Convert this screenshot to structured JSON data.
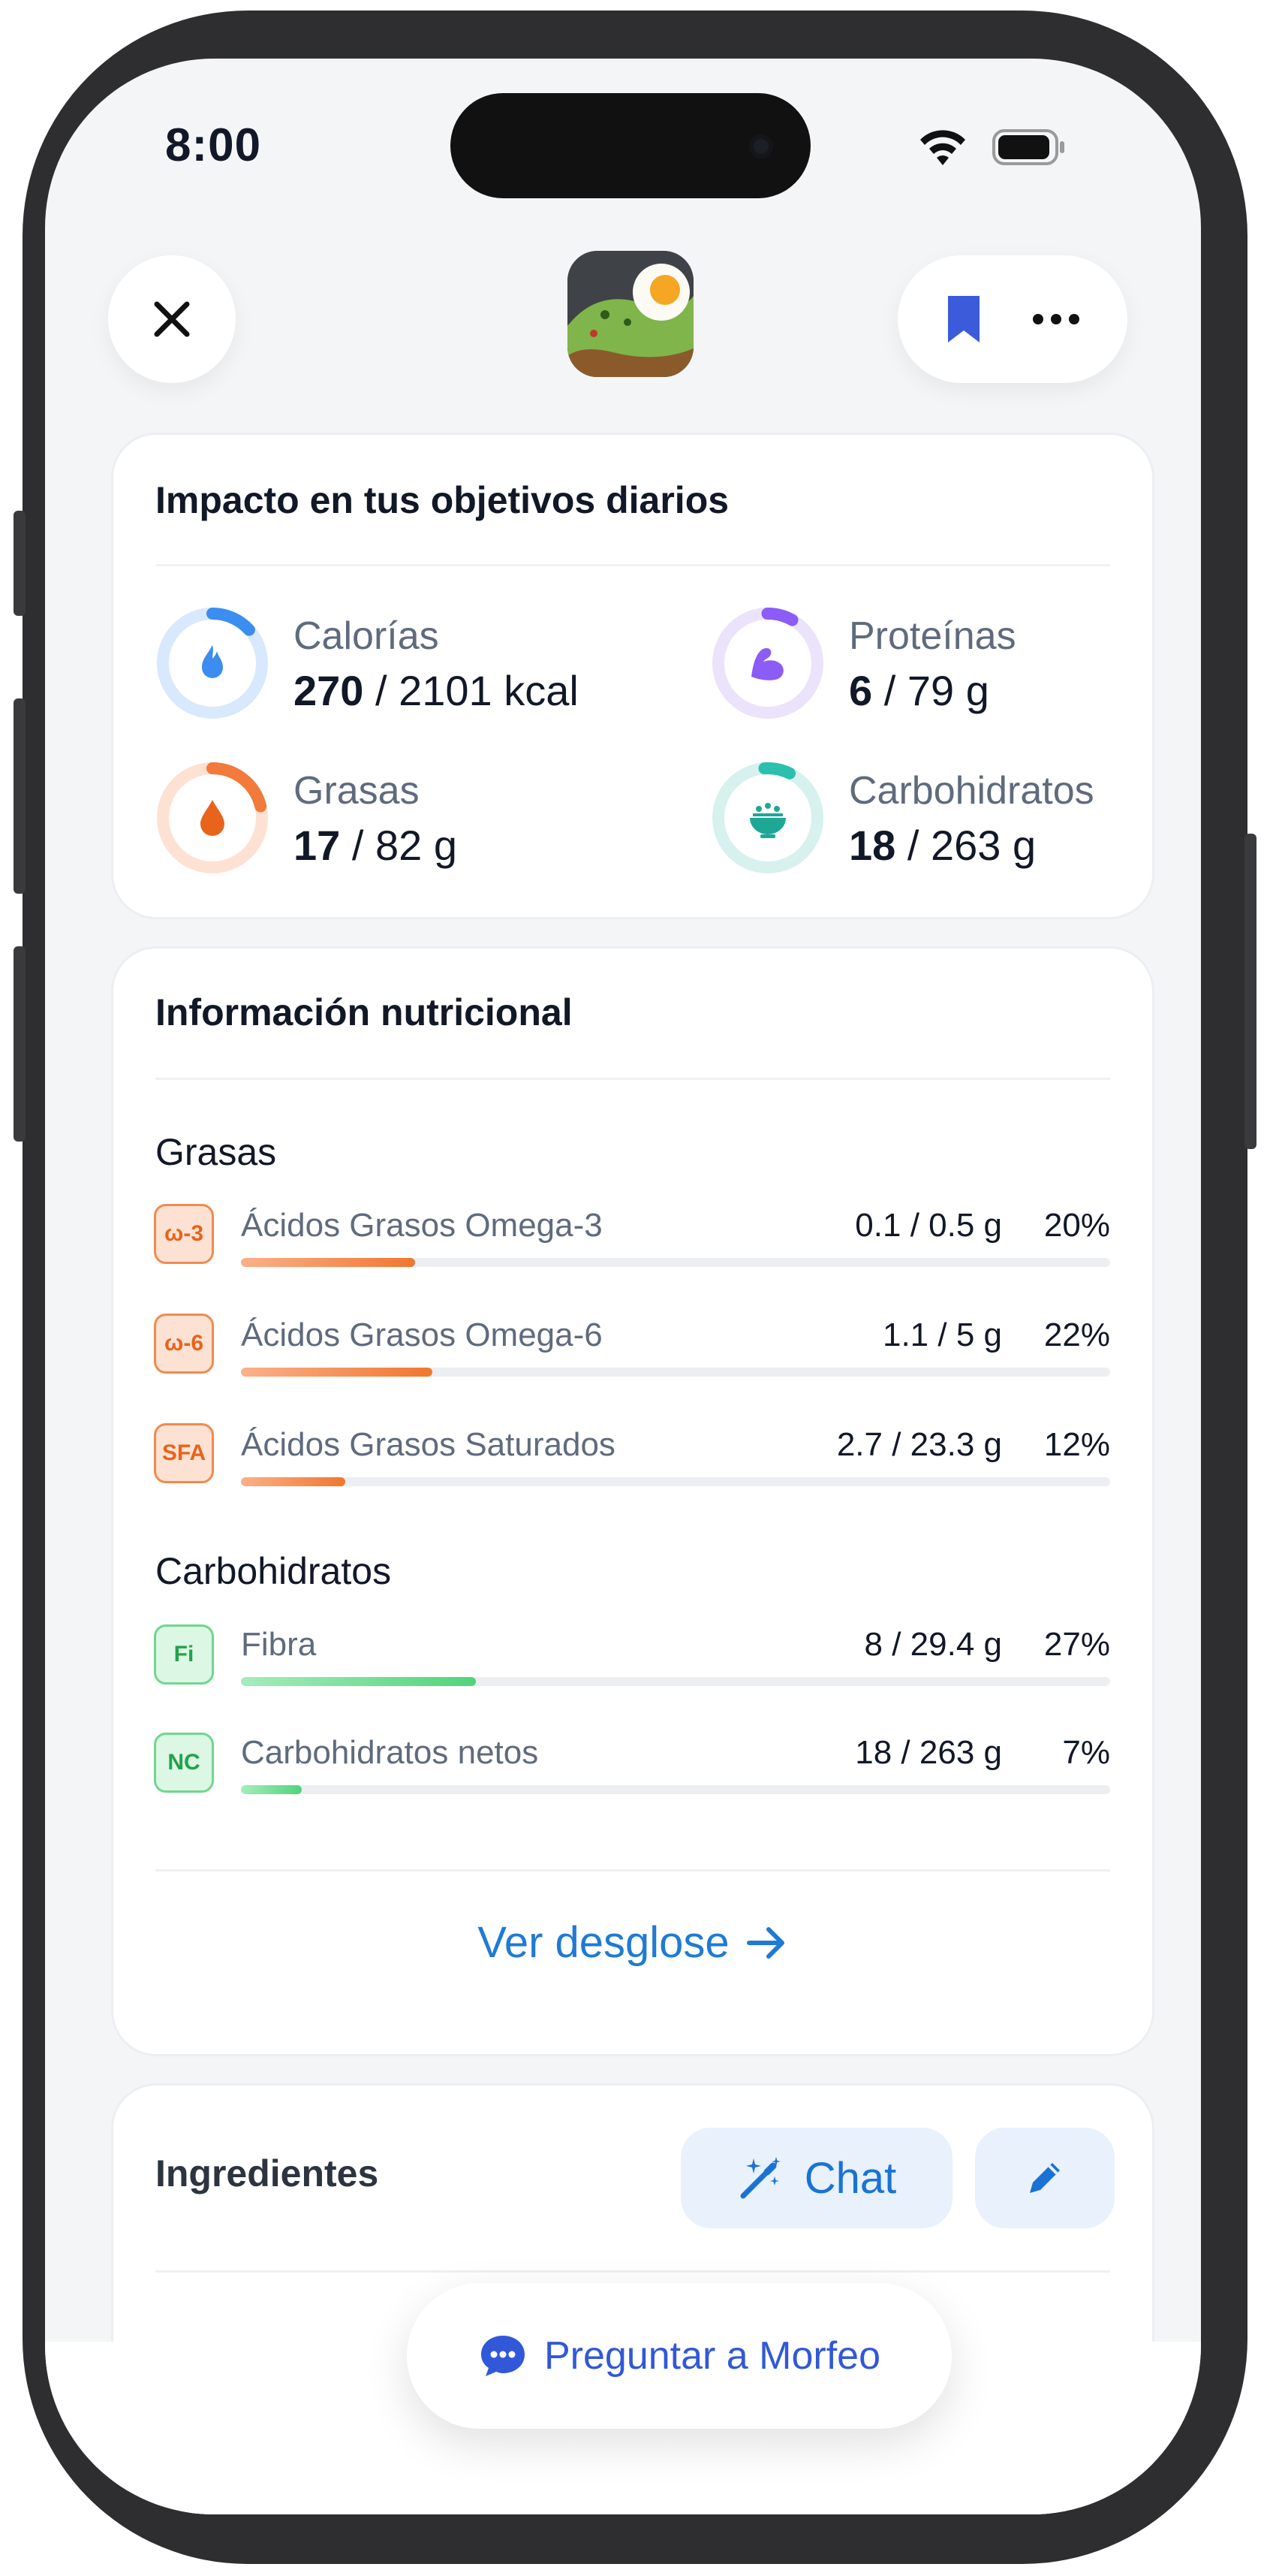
{
  "status_bar": {
    "time": "8:00"
  },
  "header": {
    "close_icon": "close-icon",
    "bookmark_icon": "bookmark-icon",
    "more_icon": "more-icon",
    "food_image": "avocado-toast-with-fried-egg"
  },
  "daily_goals": {
    "title": "Impacto en tus objetivos diarios",
    "items": [
      {
        "label": "Calorías",
        "value": "270",
        "goal": "2101 kcal",
        "icon": "flame-icon",
        "color": "#3b8df0",
        "progress": 0.13
      },
      {
        "label": "Proteínas",
        "value": "6",
        "goal": "79 g",
        "icon": "muscle-icon",
        "color": "#8b5cf6",
        "progress": 0.08
      },
      {
        "label": "Grasas",
        "value": "17",
        "goal": "82 g",
        "icon": "drop-icon",
        "color": "#f27a3a",
        "progress": 0.21
      },
      {
        "label": "Carbohidratos",
        "value": "18",
        "goal": "263 g",
        "icon": "rice-bowl-icon",
        "color": "#2bbfae",
        "progress": 0.07
      }
    ]
  },
  "nutrition": {
    "title": "Información nutricional",
    "fats": {
      "heading": "Grasas",
      "rows": [
        {
          "badge": "ω-3",
          "name": "Ácidos Grasos Omega-3",
          "amount": "0.1 / 0.5 g",
          "pct": "20%",
          "fraction": 0.2
        },
        {
          "badge": "ω-6",
          "name": "Ácidos Grasos Omega-6",
          "amount": "1.1 / 5 g",
          "pct": "22%",
          "fraction": 0.22
        },
        {
          "badge": "SFA",
          "name": "Ácidos Grasos Saturados",
          "amount": "2.7 / 23.3 g",
          "pct": "12%",
          "fraction": 0.12
        }
      ]
    },
    "carbs": {
      "heading": "Carbohidratos",
      "rows": [
        {
          "badge": "Fi",
          "name": "Fibra",
          "amount": "8 / 29.4 g",
          "pct": "27%",
          "fraction": 0.27
        },
        {
          "badge": "NC",
          "name": "Carbohidratos netos",
          "amount": "18 / 263 g",
          "pct": "7%",
          "fraction": 0.07
        }
      ]
    },
    "breakdown_link": "Ver desglose"
  },
  "ingredients": {
    "title": "Ingredientes",
    "chat_label": "Chat",
    "chat_icon": "magic-wand-icon",
    "edit_icon": "pencil-icon"
  },
  "floating_button": {
    "label": "Preguntar a Morfeo",
    "icon": "chat-bubble-icon"
  }
}
